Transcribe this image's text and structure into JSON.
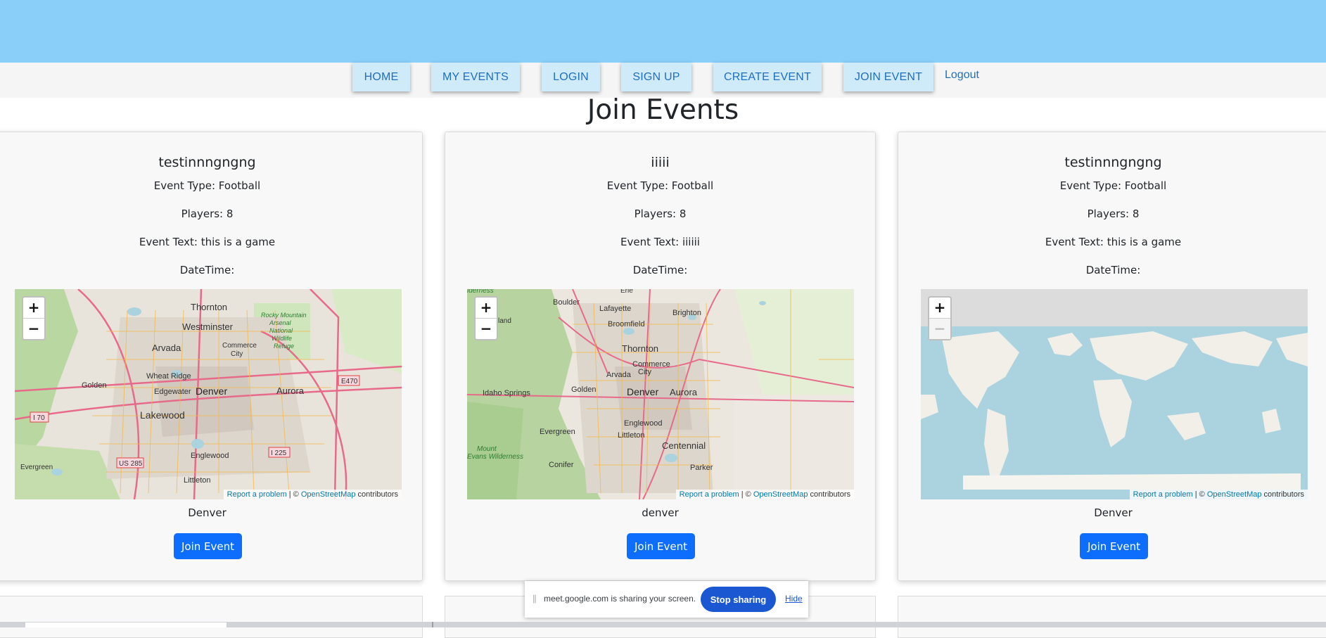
{
  "nav": {
    "items": [
      {
        "label": "HOME"
      },
      {
        "label": "MY EVENTS"
      },
      {
        "label": "LOGIN"
      },
      {
        "label": "SIGN UP"
      },
      {
        "label": "CREATE EVENT"
      },
      {
        "label": "JOIN EVENT"
      }
    ],
    "logout": "Logout"
  },
  "page": {
    "title": "Join Events"
  },
  "events": [
    {
      "title": "testinnngngng",
      "event_type": "Event Type: Football",
      "players": "Players: 8",
      "event_text": "Event Text: this is a game",
      "datetime": "DateTime:",
      "location": "Denver",
      "join_label": "Join Event"
    },
    {
      "title": "iiiii",
      "event_type": "Event Type: Football",
      "players": "Players: 8",
      "event_text": "Event Text: iiiiii",
      "datetime": "DateTime:",
      "location": "denver",
      "join_label": "Join Event"
    },
    {
      "title": "testinnngngng",
      "event_type": "Event Type: Football",
      "players": "Players: 8",
      "event_text": "Event Text: this is a game",
      "datetime": "DateTime:",
      "location": "Denver",
      "join_label": "Join Event"
    }
  ],
  "map": {
    "zoom_in": "+",
    "zoom_out": "−",
    "report": "Report a problem",
    "separator": " | © ",
    "osm": "OpenStreetMap",
    "contributors": " contributors",
    "labels_map1": [
      "Thornton",
      "Westminster",
      "Rocky Mountain",
      "Arsenal",
      "National",
      "Wildlife",
      "Refuge",
      "Arvada",
      "Commerce",
      "City",
      "Wheat Ridge",
      "Golden",
      "Edgewater",
      "Denver",
      "Aurora",
      "E470",
      "Lakewood",
      "I 70",
      "US 285",
      "I 225",
      "Englewood",
      "Evergreen",
      "Littleton"
    ],
    "labels_map2": [
      "Boulder",
      "Erie",
      "Lafayette",
      "Brighton",
      "Broomfield",
      "Thornton",
      "Commerce",
      "City",
      "Arvada",
      "Golden",
      "Idaho Springs",
      "Denver",
      "Aurora",
      "Englewood",
      "Littleton",
      "Centennial",
      "Evergreen",
      "Conifer",
      "Parker",
      "Mount",
      "Evans Wilderness",
      "lderness",
      "ederland"
    ]
  },
  "share_bar": {
    "message": "meet.google.com is sharing your screen.",
    "stop": "Stop sharing",
    "hide": "Hide"
  },
  "colors": {
    "banner": "#89cff9",
    "nav_button": "#cfeaf8",
    "join_button": "#0d6efd",
    "stop_sharing": "#1a57d1"
  }
}
